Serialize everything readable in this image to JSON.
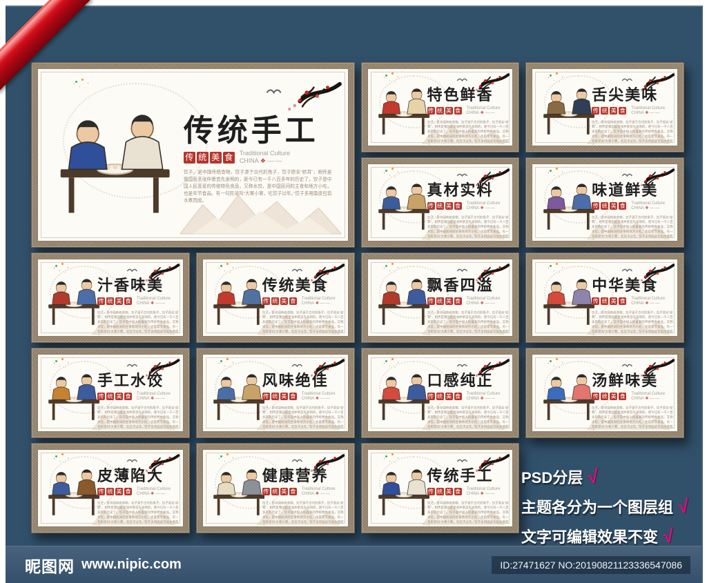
{
  "colors": {
    "canvas_bg": "#31506a",
    "frame_tan": "#97866f",
    "panel_bg": "#fcfbf6",
    "seal_red": "#b5352b",
    "ribbon_red": "#e31420",
    "check_pink": "#f0047f",
    "footer_bg": "#3d5a73"
  },
  "shared": {
    "seal_chars": [
      "传",
      "统",
      "美",
      "食"
    ],
    "subtitle_en": "Traditional Culture",
    "subtitle_cn": "CHINA",
    "ornament": "❖",
    "dash": "—·—",
    "desc": "饺子，是中国传统食物，饺子源于古代的角子，饺子原名“娇耳”，相传是我国医圣张仲景首先发明的，距今已有一千八百多年的历史了。饺子是中国人民喜爱的传统特色食品，又称水饺，是中国民间的主食和地方小吃，也是年节食品。有一句民谣叫“大寒小寒，吃饺子过年。”饺子多用面皮包馅水煮而成。"
  },
  "panels": [
    {
      "title": "传统手工",
      "size": "large",
      "scene": "family-making-dumplings",
      "fig1": "#2f4f9a",
      "fig2": "#e9e2d2"
    },
    {
      "title": "特色鲜香",
      "size": "small",
      "scene": "woman-cooking-at-stove",
      "fig1": "#c23b2e",
      "fig2": "#e6d3a8"
    },
    {
      "title": "舌尖美味",
      "size": "small",
      "scene": "diners-around-table",
      "fig1": "#8a6a45",
      "fig2": "#2f3f55"
    },
    {
      "title": "真材实料",
      "size": "small",
      "scene": "cook-at-wok",
      "fig1": "#3c5c9e",
      "fig2": "#c9a267"
    },
    {
      "title": "味道鲜美",
      "size": "small",
      "scene": "friends-eating-dumplings",
      "fig1": "#7d59a0",
      "fig2": "#4b6ea8"
    },
    {
      "title": "汁香味美",
      "size": "small",
      "scene": "making-dumplings-long-table",
      "fig1": "#b23a2c",
      "fig2": "#4b6ea8"
    },
    {
      "title": "传统美食",
      "size": "small",
      "scene": "baker-at-clay-oven",
      "fig1": "#c23b2e",
      "fig2": "#51719f"
    },
    {
      "title": "飘香四溢",
      "size": "small",
      "scene": "two-men-tasting",
      "fig1": "#b23a2c",
      "fig2": "#3c5c9e"
    },
    {
      "title": "中华美食",
      "size": "small",
      "scene": "cook-serving-table",
      "fig1": "#d44a3c",
      "fig2": "#8f84ad"
    },
    {
      "title": "手工水饺",
      "size": "small",
      "scene": "rolling-dough",
      "fig1": "#c8822f",
      "fig2": "#3c5c9e"
    },
    {
      "title": "风味绝佳",
      "size": "small",
      "scene": "steamed-bun-baskets",
      "fig1": "#4b6ea8",
      "fig2": "#c9a267"
    },
    {
      "title": "口感纯正",
      "size": "small",
      "scene": "family-at-yellow-table",
      "fig1": "#d44a3c",
      "fig2": "#3c5c9e"
    },
    {
      "title": "汤鲜味美",
      "size": "small",
      "scene": "vendors-with-soup",
      "fig1": "#3b6cc0",
      "fig2": "#e2756d"
    },
    {
      "title": "皮薄陷大",
      "size": "small",
      "scene": "wrapping-dumplings",
      "fig1": "#3c5c9e",
      "fig2": "#8a5a2c"
    },
    {
      "title": "健康营养",
      "size": "small",
      "scene": "chef-with-dishes",
      "fig1": "#e7dbc0",
      "fig2": "#8b9099"
    },
    {
      "title": "传统手工",
      "size": "small",
      "scene": "family-making-dumplings",
      "fig1": "#2f4f9a",
      "fig2": "#e9e2d2"
    }
  ],
  "annotation": {
    "check": "√",
    "lines": [
      {
        "text": "PSD分层"
      },
      {
        "text": "主题各分为一个图层组"
      },
      {
        "text": "文字可编辑效果不变"
      }
    ]
  },
  "footer": {
    "brand": "昵图网",
    "url": "www.nipic.com",
    "id_text": "ID:27471627 NO:20190821123336547086"
  }
}
